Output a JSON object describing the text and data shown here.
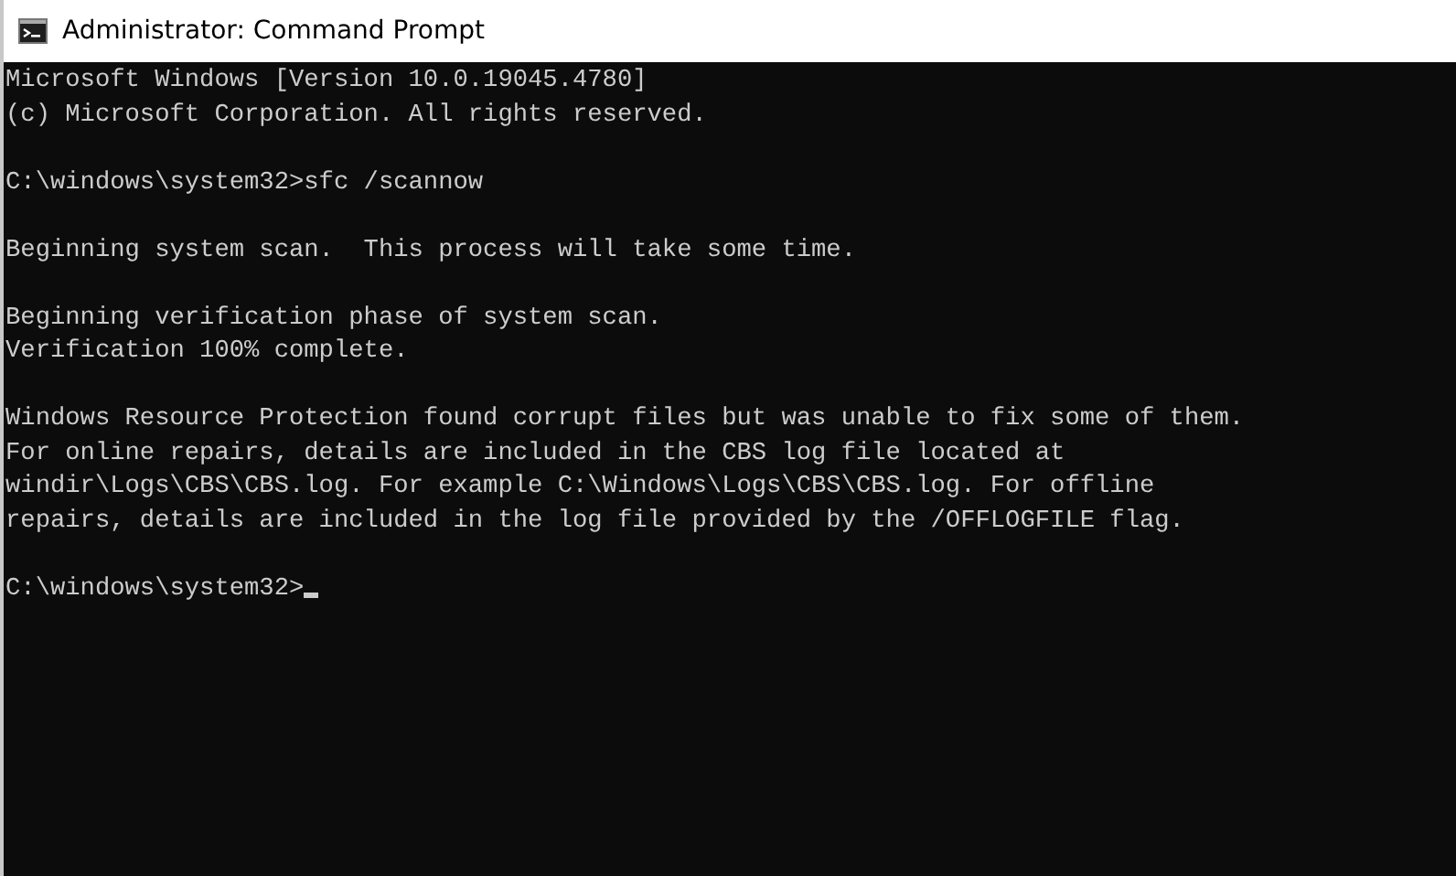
{
  "window": {
    "title": "Administrator: Command Prompt"
  },
  "console": {
    "blocks": [
      [
        "Microsoft Windows [Version 10.0.19045.4780]",
        "(c) Microsoft Corporation. All rights reserved."
      ],
      [
        "C:\\windows\\system32>sfc /scannow"
      ],
      [
        "Beginning system scan.  This process will take some time."
      ],
      [
        "Beginning verification phase of system scan.",
        "Verification 100% complete."
      ],
      [
        "Windows Resource Protection found corrupt files but was unable to fix some of them.",
        "For online repairs, details are included in the CBS log file located at",
        "windir\\Logs\\CBS\\CBS.log. For example C:\\Windows\\Logs\\CBS\\CBS.log. For offline",
        "repairs, details are included in the log file provided by the /OFFLOGFILE flag."
      ]
    ],
    "prompt": {
      "text": "C:\\windows\\system32>",
      "cursor": true
    }
  }
}
